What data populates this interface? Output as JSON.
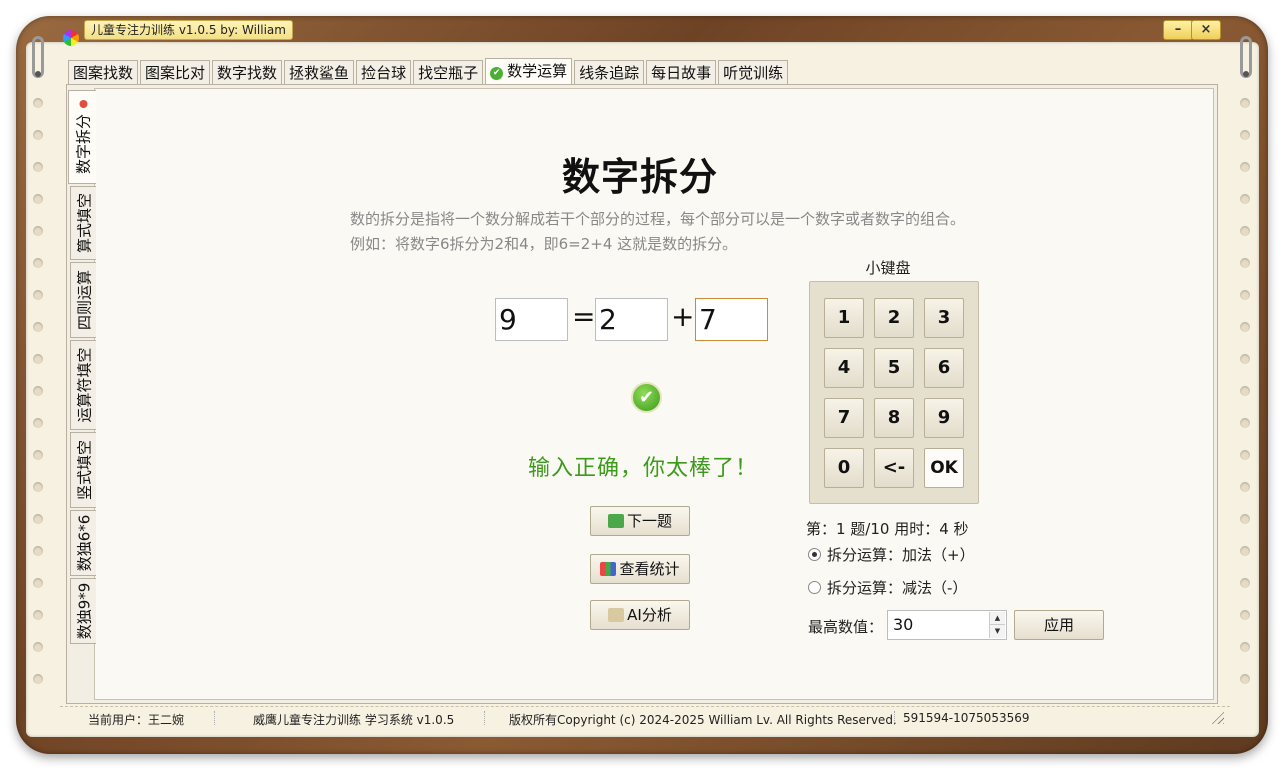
{
  "window": {
    "title": "儿童专注力训练 v1.0.5 by: William",
    "minimize_label": "–",
    "close_label": "×"
  },
  "top_tabs": [
    {
      "label": "图案找数"
    },
    {
      "label": "图案比对"
    },
    {
      "label": "数字找数"
    },
    {
      "label": "拯救鲨鱼"
    },
    {
      "label": "捡台球"
    },
    {
      "label": "找空瓶子"
    },
    {
      "label": "数学运算",
      "active": true,
      "icon": "check-circle-icon"
    },
    {
      "label": "线条追踪"
    },
    {
      "label": "每日故事"
    },
    {
      "label": "听觉训练"
    }
  ],
  "side_tabs": [
    {
      "label": "数字拆分",
      "active": true
    },
    {
      "label": "算式填空"
    },
    {
      "label": "四则运算"
    },
    {
      "label": "运算符填空"
    },
    {
      "label": "竖式填空"
    },
    {
      "label": "数独6*6"
    },
    {
      "label": "数独9*9"
    }
  ],
  "exercise": {
    "title": "数字拆分",
    "desc_line1": "数的拆分是指将一个数分解成若干个部分的过程，每个部分可以是一个数字或者数字的组合。",
    "desc_line2": "例如：将数字6拆分为2和4，即6=2+4 这就是数的拆分。",
    "equation": {
      "total": "9",
      "equals": "=",
      "part1": "2",
      "operator": "+",
      "part2": "7"
    },
    "result_message": "输入正确，你太棒了！",
    "next_button": "下一题",
    "stats_button": "查看统计",
    "ai_button": "AI分析"
  },
  "keypad": {
    "title": "小键盘",
    "keys": [
      "1",
      "2",
      "3",
      "4",
      "5",
      "6",
      "7",
      "8",
      "9",
      "0",
      "<-",
      "OK"
    ]
  },
  "settings": {
    "progress_text": "第：1 题/10 用时：4 秒",
    "mode_add": "拆分运算：加法（+）",
    "mode_sub": "拆分运算：减法（-）",
    "selected_mode": "add",
    "max_label": "最高数值：",
    "max_value": "30",
    "apply_button": "应用"
  },
  "status_bar": {
    "user": "当前用户：王二婉",
    "app": "威鹰儿童专注力训练 学习系统 v1.0.5",
    "copyright": "版权所有Copyright (c) 2024-2025 William Lv. All Rights Reserved.",
    "contact": "591594-1075053569"
  },
  "colors": {
    "accent_green": "#3c9a1c",
    "frame_wood": "#7a4c2a",
    "paper": "#f7f1e1"
  }
}
